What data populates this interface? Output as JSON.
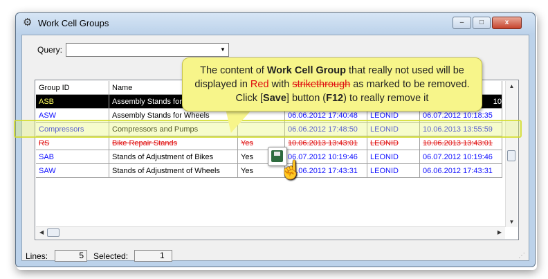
{
  "window": {
    "title": "Work Cell Groups",
    "buttons": {
      "minimize": "–",
      "maximize": "□",
      "close": "x"
    }
  },
  "query": {
    "label": "Query:",
    "value": ""
  },
  "grid": {
    "columns": [
      "Group ID",
      "Name",
      "",
      "",
      "",
      ""
    ],
    "rows": [
      {
        "id": "ASB",
        "name": "Assembly Stands for",
        "active": "",
        "created": "",
        "user": "",
        "modified": "10"
      },
      {
        "id": "ASW",
        "name": "Assembly Stands for Wheels",
        "active": "",
        "created": "06.06.2012 17:40:48",
        "user": "LEONID",
        "modified": "06.07.2012 10:18:35"
      },
      {
        "id": "Compressors",
        "name": "Compressors and Pumps",
        "active": "",
        "created": "06.06.2012 17:48:50",
        "user": "LEONID",
        "modified": "10.06.2013 13:55:59"
      },
      {
        "id": "RS",
        "name": "Bike Repair Stands",
        "active": "Yes",
        "created": "10.06.2013 13:43:01",
        "user": "LEONID",
        "modified": "10.06.2013 13:43:01"
      },
      {
        "id": "SAB",
        "name": "Stands of Adjustment of Bikes",
        "active": "Yes",
        "created": "06.07.2012 10:19:46",
        "user": "LEONID",
        "modified": "06.07.2012 10:19:46"
      },
      {
        "id": "SAW",
        "name": "Stands of Adjustment of Wheels",
        "active": "Yes",
        "created": "06.06.2012 17:43:31",
        "user": "LEONID",
        "modified": "06.06.2012 17:43:31"
      }
    ]
  },
  "status": {
    "lines_label": "Lines:",
    "lines_value": "5",
    "selected_label": "Selected:",
    "selected_value": "1"
  },
  "callout": {
    "p1": "The content of ",
    "b1": "Work Cell Group",
    "p2": " that really not used will be displayed in ",
    "red": "Red",
    "p3": " with ",
    "strike": "strikethrough",
    "p4": " as marked to be removed.  Click [",
    "save": "Save",
    "p5": "] button (",
    "key": "F12",
    "p6": ") to really remove it"
  },
  "icons": {
    "app": "work-cell-groups-icon",
    "save": "floppy-disk-icon",
    "cursor": "hand-pointer-icon"
  }
}
